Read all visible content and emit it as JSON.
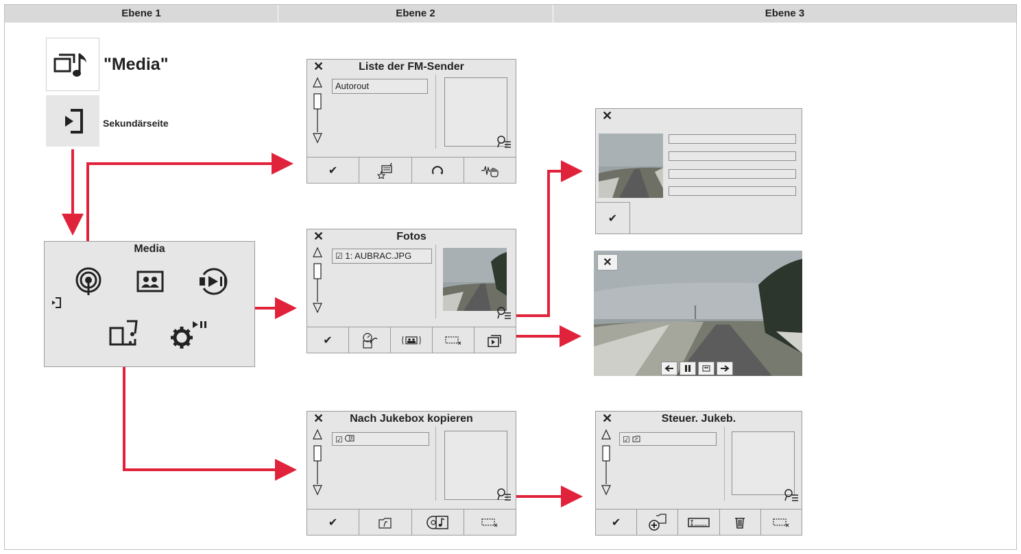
{
  "columns": [
    "Ebene 1",
    "Ebene 2",
    "Ebene 3"
  ],
  "level1": {
    "title": "\"Media\"",
    "secondary_label": "Sekundärseite"
  },
  "media_panel": {
    "title": "Media"
  },
  "fm_panel": {
    "title": "Liste der FM-Sender",
    "item": "Autorout"
  },
  "photos_panel": {
    "title": "Fotos",
    "item": "1: AUBRAC.JPG"
  },
  "jukebox_copy_panel": {
    "title": "Nach Jukebox kopieren"
  },
  "jukebox_control_panel": {
    "title": "Steuer. Jukeb."
  },
  "colors": {
    "arrow": "#e0223a",
    "panel": "#e6e6e6",
    "header": "#d9d9d9"
  },
  "icons": [
    "close-icon",
    "check-icon",
    "radio-icon",
    "photo-icon",
    "play-pause-icon",
    "music-folder-icon",
    "settings-play-icon",
    "back-icon",
    "zoom-list-icon",
    "slideshow-icon",
    "trash-icon"
  ]
}
